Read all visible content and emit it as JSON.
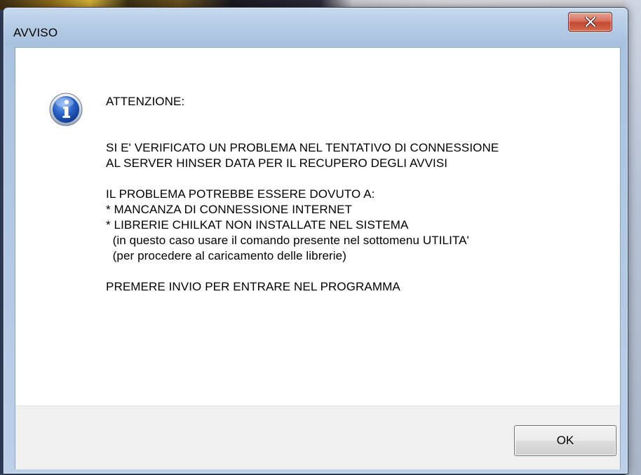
{
  "window": {
    "title": "AVVISO"
  },
  "dialog": {
    "icon": "info-icon",
    "message_lines": [
      "ATTENZIONE:",
      "",
      "",
      "SI E' VERIFICATO UN PROBLEMA NEL TENTATIVO DI CONNESSIONE",
      "AL SERVER HINSER DATA PER IL RECUPERO DEGLI AVVISI",
      "",
      "IL PROBLEMA POTREBBE ESSERE DOVUTO A:",
      "* MANCANZA DI CONNESSIONE INTERNET",
      "* LIBRERIE CHILKAT NON INSTALLATE NEL SISTEMA",
      "  (in questo caso usare il comando presente nel sottomenu UTILITA'",
      "  (per procedere al caricamento delle librerie)",
      "",
      "PREMERE INVIO PER ENTRARE NEL PROGRAMMA"
    ],
    "ok_label": "OK"
  },
  "colors": {
    "close_button": "#c54a33",
    "footer_bg": "#f0f0f0",
    "info_icon": "#2a62c9"
  }
}
